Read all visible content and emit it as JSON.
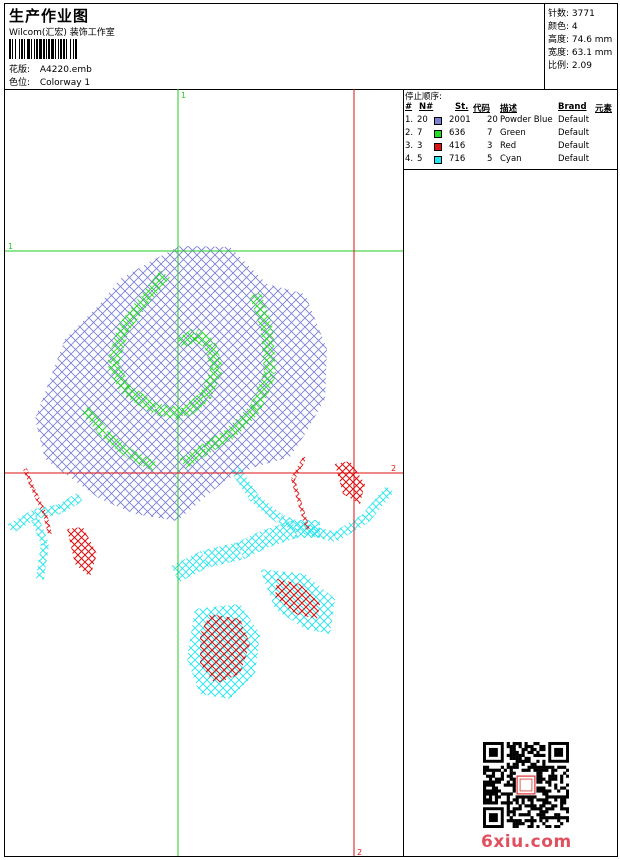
{
  "header": {
    "title": "生产作业图",
    "company": "Wilcom(汇宏) 装饰工作室",
    "pattern_label": "花版:",
    "pattern_value": "A4220.emb",
    "colorway_label": "色位:",
    "colorway_value": "Colorway 1"
  },
  "stats": {
    "stitches": "针数: 3771",
    "colors": "颜色: 4",
    "height": "高度: 74.6 mm",
    "width": "宽度: 63.1 mm",
    "scale": "比例: 2.09"
  },
  "guides": {
    "top_label": "1",
    "left_label": "1",
    "right_label": "2",
    "bottom_label": "2"
  },
  "stop_sequence": {
    "title": "停止顺序:",
    "columns": [
      "#",
      "N#",
      "St.",
      "代码",
      "描述",
      "Brand",
      "元素"
    ],
    "rows": [
      {
        "idx": "1.",
        "n": "20",
        "color": "#7B7FD6",
        "st": "2001",
        "code": "20",
        "desc": "Powder Blue",
        "brand": "Default"
      },
      {
        "idx": "2.",
        "n": "7",
        "color": "#22DD22",
        "st": "636",
        "code": "7",
        "desc": "Green",
        "brand": "Default"
      },
      {
        "idx": "3.",
        "n": "3",
        "color": "#DD1111",
        "st": "416",
        "code": "3",
        "desc": "Red",
        "brand": "Default"
      },
      {
        "idx": "4.",
        "n": "5",
        "color": "#22E5EE",
        "st": "716",
        "code": "5",
        "desc": "Cyan",
        "brand": "Default"
      }
    ]
  },
  "colors": {
    "guide_green": "#22CC22",
    "guide_red": "#DD1111",
    "blue": "#7B7FD6",
    "green": "#22DD22",
    "red": "#DD1111",
    "cyan": "#22E5EE"
  },
  "watermark": {
    "text": "6xiu.com"
  },
  "icons": [
    "barcode-icon",
    "qr-code-icon",
    "seal-stamp-icon"
  ]
}
